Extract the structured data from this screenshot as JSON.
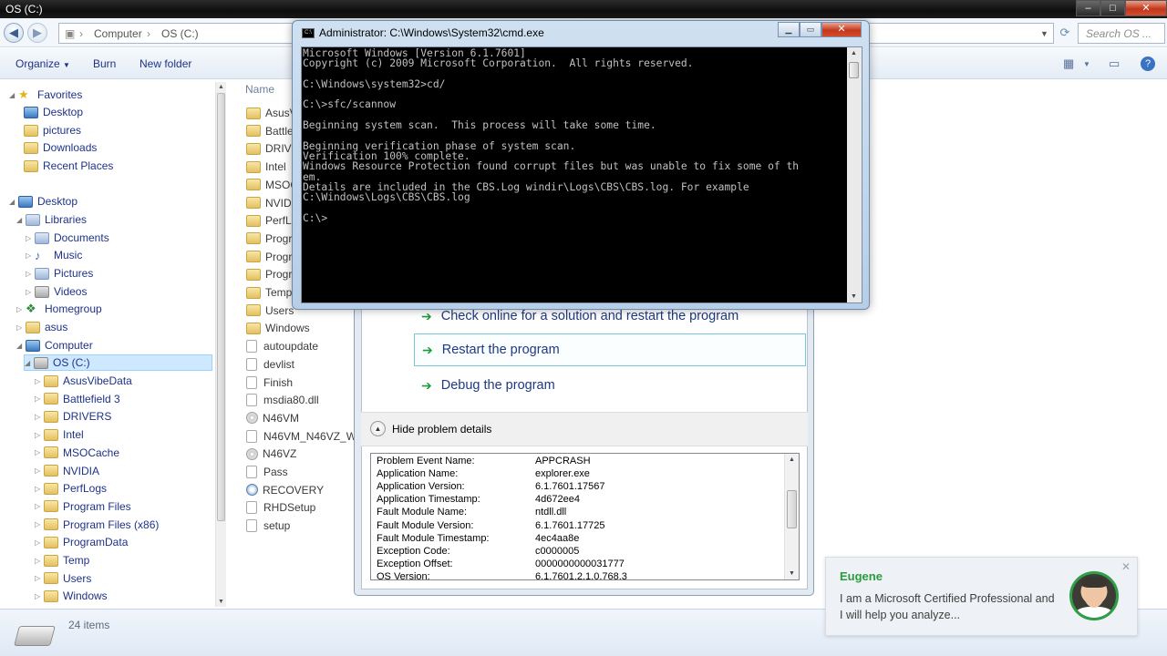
{
  "explorer": {
    "title": "OS (C:)",
    "breadcrumb": [
      "Computer",
      "OS (C:)"
    ],
    "search_placeholder": "Search OS ...",
    "toolbar": {
      "organize": "Organize",
      "burn": "Burn",
      "new_folder": "New folder"
    },
    "nav": {
      "favorites": "Favorites",
      "favorite_items": [
        "Desktop",
        "pictures",
        "Downloads",
        "Recent Places"
      ],
      "desktop": "Desktop",
      "libraries": "Libraries",
      "library_items": [
        "Documents",
        "Music",
        "Pictures",
        "Videos"
      ],
      "homegroup": "Homegroup",
      "asus": "asus",
      "computer": "Computer",
      "drive": "OS (C:)",
      "drive_folders": [
        "AsusVibeData",
        "Battlefield 3",
        "DRIVERS",
        "Intel",
        "MSOCache",
        "NVIDIA",
        "PerfLogs",
        "Program Files",
        "Program Files (x86)",
        "ProgramData",
        "Temp",
        "Users",
        "Windows"
      ]
    },
    "column_name": "Name",
    "files": [
      {
        "name": "AsusV",
        "type": "folder"
      },
      {
        "name": "Battle",
        "type": "folder"
      },
      {
        "name": "DRIVE",
        "type": "folder"
      },
      {
        "name": "Intel",
        "type": "folder"
      },
      {
        "name": "MSOC",
        "type": "folder"
      },
      {
        "name": "NVIDIA",
        "type": "folder"
      },
      {
        "name": "PerfLo",
        "type": "folder"
      },
      {
        "name": "Progra",
        "type": "folder"
      },
      {
        "name": "Progra",
        "type": "folder"
      },
      {
        "name": "Progra",
        "type": "folder"
      },
      {
        "name": "Temp",
        "type": "folder"
      },
      {
        "name": "Users",
        "type": "folder"
      },
      {
        "name": "Windows",
        "type": "folder"
      },
      {
        "name": "autoupdate",
        "type": "doc"
      },
      {
        "name": "devlist",
        "type": "doc"
      },
      {
        "name": "Finish",
        "type": "doc"
      },
      {
        "name": "msdia80.dll",
        "type": "doc"
      },
      {
        "name": "N46VM",
        "type": "disc"
      },
      {
        "name": "N46VM_N46VZ_WIN",
        "type": "doc"
      },
      {
        "name": "N46VZ",
        "type": "disc"
      },
      {
        "name": "Pass",
        "type": "doc"
      },
      {
        "name": "RECOVERY",
        "type": "rec"
      },
      {
        "name": "RHDSetup",
        "type": "doc"
      },
      {
        "name": "setup",
        "type": "doc"
      }
    ],
    "status_count": "24 items"
  },
  "cmd": {
    "title": "Administrator: C:\\Windows\\System32\\cmd.exe",
    "lines": [
      "Microsoft Windows [Version 6.1.7601]",
      "Copyright (c) 2009 Microsoft Corporation.  All rights reserved.",
      "",
      "C:\\Windows\\system32>cd/",
      "",
      "C:\\>sfc/scannow",
      "",
      "Beginning system scan.  This process will take some time.",
      "",
      "Beginning verification phase of system scan.",
      "Verification 100% complete.",
      "Windows Resource Protection found corrupt files but was unable to fix some of th",
      "em.",
      "Details are included in the CBS.Log windir\\Logs\\CBS\\CBS.log. For example",
      "C:\\Windows\\Logs\\CBS\\CBS.log",
      "",
      "C:\\>_"
    ]
  },
  "dialog": {
    "options": [
      "Check online for a solution and restart the program",
      "Restart the program",
      "Debug the program"
    ],
    "hide_details": "Hide problem details",
    "details": [
      {
        "k": "Problem Event Name:",
        "v": "APPCRASH"
      },
      {
        "k": "Application Name:",
        "v": "explorer.exe"
      },
      {
        "k": "Application Version:",
        "v": "6.1.7601.17567"
      },
      {
        "k": "Application Timestamp:",
        "v": "4d672ee4"
      },
      {
        "k": "Fault Module Name:",
        "v": "ntdll.dll"
      },
      {
        "k": "Fault Module Version:",
        "v": "6.1.7601.17725"
      },
      {
        "k": "Fault Module Timestamp:",
        "v": "4ec4aa8e"
      },
      {
        "k": "Exception Code:",
        "v": "c0000005"
      },
      {
        "k": "Exception Offset:",
        "v": "0000000000031777"
      },
      {
        "k": "OS Version:",
        "v": "6.1.7601.2.1.0.768.3"
      }
    ]
  },
  "chat": {
    "name": "Eugene",
    "message": "I am a Microsoft Certified Professional and I will help you analyze..."
  }
}
